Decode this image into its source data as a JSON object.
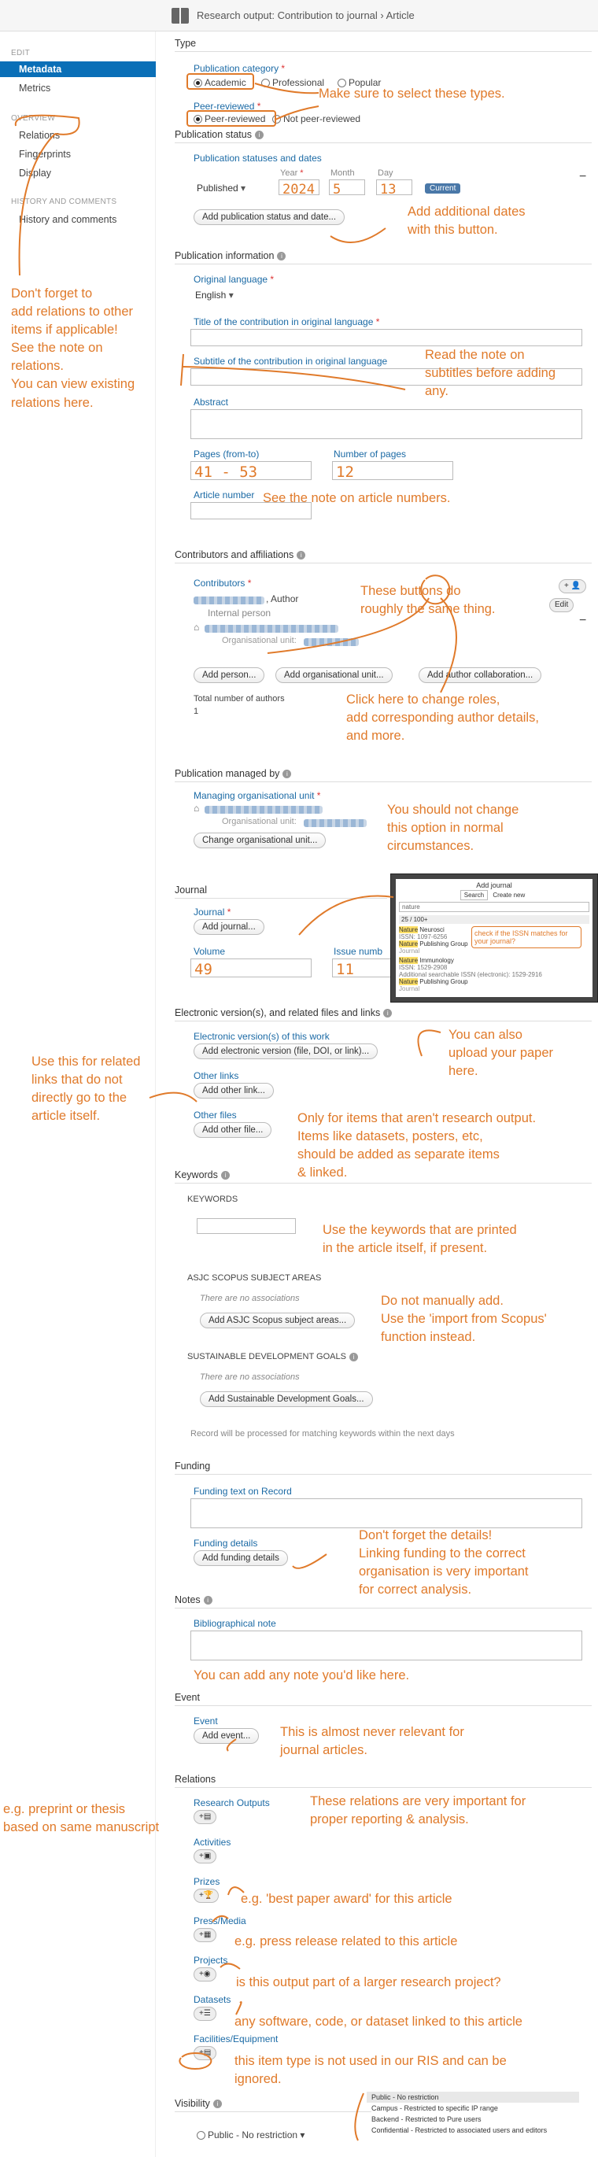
{
  "window": {
    "title": "Research output: Contribution to journal › Article"
  },
  "sidebar": {
    "edit_header": "EDIT",
    "metadata": "Metadata",
    "metrics": "Metrics",
    "overview_header": "OVERVIEW",
    "relations": "Relations",
    "fingerprints": "Fingerprints",
    "display": "Display",
    "history_header": "HISTORY AND COMMENTS",
    "history": "History and comments"
  },
  "type": {
    "header": "Type",
    "category_label": "Publication category",
    "academic": "Academic",
    "professional": "Professional",
    "popular": "Popular",
    "peer_label": "Peer-reviewed",
    "peer": "Peer-reviewed",
    "not_peer": "Not peer-reviewed"
  },
  "status": {
    "header": "Publication status",
    "dates_label": "Publication statuses and dates",
    "published": "Published",
    "year_label": "Year",
    "month_label": "Month",
    "day_label": "Day",
    "year": "2024",
    "month": "5",
    "day": "13",
    "current": "Current",
    "add_btn": "Add publication status and date..."
  },
  "info": {
    "header": "Publication information",
    "orig_lang_label": "Original language",
    "orig_lang": "English",
    "title_label": "Title of the contribution in original language",
    "subtitle_label": "Subtitle of the contribution in original language",
    "abstract_label": "Abstract",
    "pages_label": "Pages (from-to)",
    "pages": "41 - 53",
    "num_pages_label": "Number of pages",
    "num_pages": "12",
    "article_number_label": "Article number"
  },
  "contributors": {
    "header": "Contributors and affiliations",
    "label": "Contributors",
    "role": ", Author",
    "internal": "Internal person",
    "org_unit": "Organisational unit:",
    "add_person": "Add person...",
    "add_org": "Add organisational unit...",
    "add_collab": "Add author collaboration...",
    "total_label": "Total number of authors",
    "total": "1",
    "edit": "Edit",
    "plus": "+"
  },
  "managed": {
    "header": "Publication managed by",
    "label": "Managing organisational unit",
    "org_unit": "Organisational unit:",
    "change": "Change organisational unit..."
  },
  "journal": {
    "header": "Journal",
    "label": "Journal",
    "add": "Add journal...",
    "volume_label": "Volume",
    "volume": "49",
    "issue_label": "Issue numb",
    "issue": "11"
  },
  "popup": {
    "title": "Add journal",
    "search_tab": "Search",
    "create_tab": "Create new",
    "query": "nature",
    "count": "25 / 100+",
    "r1_title": "Neurosci",
    "r1_hl": "Nature",
    "r1_issn": "ISSN: 1097-6256",
    "r1_pub_hl": "Nature",
    "r1_pub": "Publishing Group",
    "r1_type": "Journal",
    "r2_title": "Immunology",
    "r2_hl": "Nature",
    "r2_issn": "ISSN: 1529-2908",
    "r2_extra": "Additional searchable ISSN (electronic): 1529-2916",
    "r2_pub_hl": "Nature",
    "r2_pub": "Publishing Group",
    "r2_type": "Journal",
    "check_note": "check if the ISSN matches for your journal?"
  },
  "files": {
    "header": "Electronic version(s), and related files and links",
    "ev_label": "Electronic version(s) of this work",
    "ev_add": "Add electronic version (file, DOI, or link)...",
    "links_label": "Other links",
    "links_add": "Add other link...",
    "other_files_label": "Other files",
    "other_files_add": "Add other file..."
  },
  "keywords": {
    "header": "Keywords",
    "kw": "KEYWORDS",
    "asjc": "ASJC SCOPUS SUBJECT AREAS",
    "no_assoc": "There are no associations",
    "asjc_add": "Add ASJC Scopus subject areas...",
    "sdg": "SUSTAINABLE DEVELOPMENT GOALS",
    "sdg_no_assoc": "There are no associations",
    "sdg_add": "Add Sustainable Development Goals...",
    "record_note": "Record will be processed for matching keywords within the next days"
  },
  "funding": {
    "header": "Funding",
    "text_label": "Funding text on Record",
    "details_label": "Funding details",
    "add": "Add funding details"
  },
  "notes": {
    "header": "Notes",
    "label": "Bibliographical note"
  },
  "event": {
    "header": "Event",
    "label": "Event",
    "add": "Add event..."
  },
  "relations": {
    "header": "Relations",
    "research_outputs": "Research Outputs",
    "activities": "Activities",
    "prizes": "Prizes",
    "press": "Press/Media",
    "projects": "Projects",
    "datasets": "Datasets",
    "facilities": "Facilities/Equipment"
  },
  "visibility": {
    "header": "Visibility",
    "value": "Public - No restriction",
    "opt1": "Public - No restriction",
    "opt2": "Campus - Restricted to specific IP range",
    "opt3": "Backend - Restricted to Pure users",
    "opt4": "Confidential - Restricted to associated users and editors"
  },
  "notes_overlay": {
    "n_types": "Make sure to select these types.",
    "n_dates": "Add additional dates\nwith this button.",
    "n_relations": "Don't forget to\nadd relations to other\nitems if applicable!\nSee the note on\nrelations.\nYou can view existing\nrelations here.",
    "n_subtitle": "Read the note on\nsubtitles before adding\nany.",
    "n_article": "See the note on article numbers.",
    "n_buttons": "These buttons do\nroughly the same thing.",
    "n_roles": "Click here to change roles,\nadd corresponding author details,\nand more.",
    "n_managed": "You should not change\nthis option in normal\ncircumstances.",
    "n_upload": "You can also\nupload your paper\nhere.",
    "n_links": "Use this for related\nlinks that do not\ndirectly go to the\narticle itself.",
    "n_files": "Only for items that aren't research output.\nItems like datasets, posters, etc,\nshould be added as separate items\n& linked.",
    "n_keywords": "Use the keywords that are printed\nin the article itself, if present.",
    "n_asjc": "Do not manually add.\nUse the 'import from Scopus'\nfunction instead.",
    "n_funding": "Don't forget the details!\nLinking funding to the correct\norganisation is very important\nfor correct analysis.",
    "n_notes": "You can add any note you'd like here.",
    "n_event": "This is almost never relevant for\njournal articles.",
    "n_rel_imp": "These relations are very important for\nproper reporting & analysis.",
    "n_preprint": "e.g. preprint or thesis\nbased on same manuscript",
    "n_prize": "e.g. 'best paper award' for this article",
    "n_press": "e.g. press release related to this article",
    "n_project": "is this output part of a larger research project?",
    "n_data": "any software, code, or dataset linked to this article",
    "n_facil": "this item type is not used in our RIS and can be\nignored."
  },
  "colors": {
    "accent": "#0a6fb7",
    "annotation": "#e07a2a",
    "required": "#dd3333"
  }
}
